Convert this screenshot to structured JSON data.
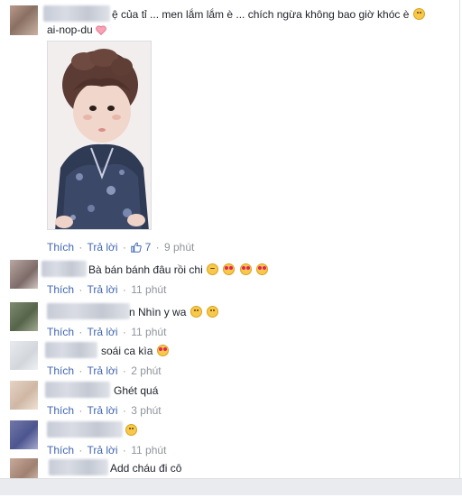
{
  "main_comment": {
    "text_line1": "ệ của tỉ ... men lắm lắm è ... chích ngừa không bao giờ khóc è",
    "text_line2": "ai-nop-du",
    "like_action": "Thích",
    "reply_action": "Trả lời",
    "like_count": "7",
    "time": "9 phút"
  },
  "replies": [
    {
      "text": "Bà bán bánh đâu rồi chi",
      "emojis": [
        "laugh",
        "heart-eyes",
        "heart-eyes",
        "heart-eyes"
      ],
      "like_action": "Thích",
      "reply_action": "Trả lời",
      "time": "11 phút"
    },
    {
      "text": "n Nhìn y wa",
      "emojis": [
        "smile",
        "smile"
      ],
      "like_action": "Thích",
      "reply_action": "Trả lời",
      "time": "11 phút"
    },
    {
      "text": "soái ca kìa",
      "emojis": [
        "heart-eyes"
      ],
      "like_action": "Thích",
      "reply_action": "Trả lời",
      "time": "2 phút"
    },
    {
      "text": "Ghét quá",
      "emojis": [],
      "like_action": "Thích",
      "reply_action": "Trả lời",
      "time": "3 phút"
    },
    {
      "text": "",
      "emojis": [
        "smile"
      ],
      "like_action": "Thích",
      "reply_action": "Trả lời",
      "time": "11 phút"
    },
    {
      "text": "Add cháu đi cô",
      "emojis": [],
      "like_action": "",
      "reply_action": "",
      "time": ""
    }
  ],
  "colors": {
    "link": "#4267b2",
    "meta": "#90949c",
    "text": "#1d2129",
    "heart": "#f25268"
  }
}
